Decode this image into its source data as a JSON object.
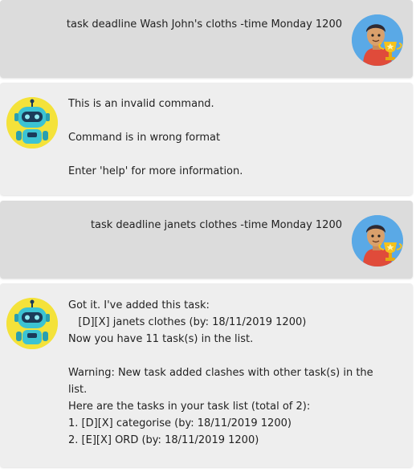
{
  "messages": [
    {
      "sender": "user",
      "text": "task deadline Wash John's cloths -time Monday 1200",
      "avatar": "trophy-boy-icon"
    },
    {
      "sender": "bot",
      "text": "This is an invalid command.\n\nCommand is in wrong format\n\nEnter 'help' for more information.",
      "avatar": "robot-icon"
    },
    {
      "sender": "user",
      "text": "task deadline janets clothes -time Monday 1200",
      "avatar": "trophy-boy-icon"
    },
    {
      "sender": "bot",
      "text": "Got it. I've added this task:\n   [D][X] janets clothes (by: 18/11/2019 1200)\nNow you have 11 task(s) in the list.\n\nWarning: New task added clashes with other task(s) in the list.\nHere are the tasks in your task list (total of 2):\n1. [D][X] categorise (by: 18/11/2019 1200)\n2. [E][X] ORD (by: 18/11/2019 1200)",
      "avatar": "robot-icon"
    }
  ],
  "colors": {
    "user_bubble": "#dcdcdc",
    "bot_bubble": "#eeeeee",
    "bot_avatar_bg": "#f4e23a",
    "user_avatar_bg": "#5aa9e6"
  }
}
